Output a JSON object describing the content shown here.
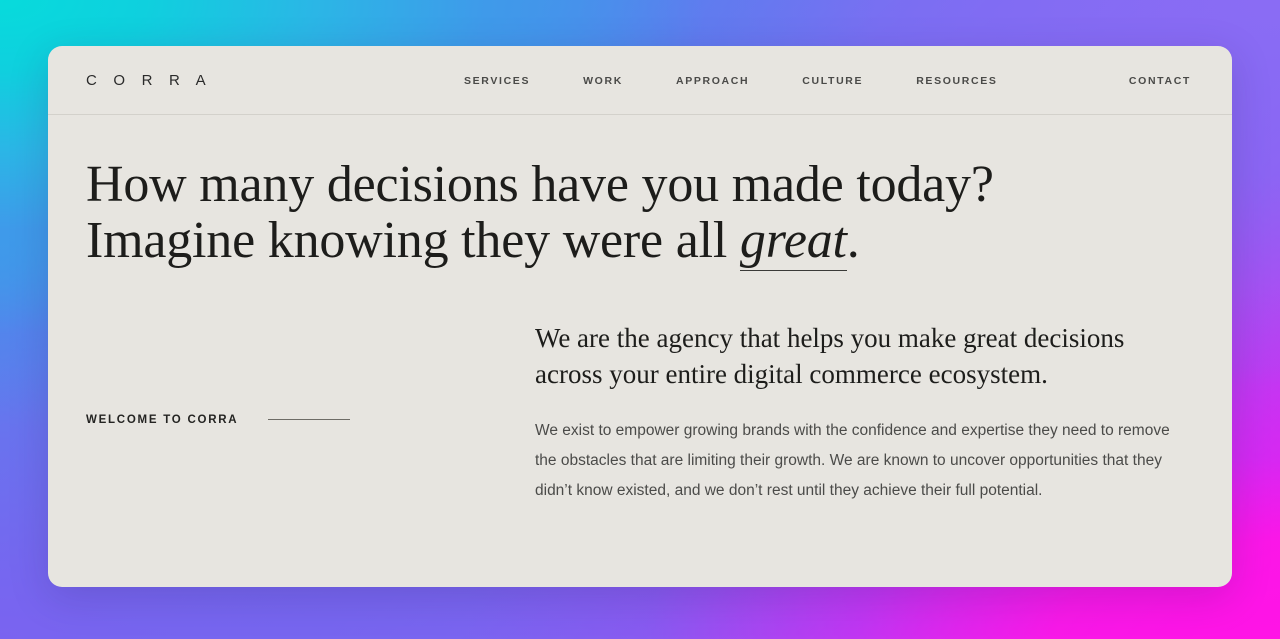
{
  "theme": {
    "card_bg": "#e7e5e0",
    "text_primary": "#1d1d1b",
    "text_secondary": "#4b4b49",
    "nav_text": "#4a4a48",
    "divider": "#d3d1cb",
    "gradient_top_left": "#0ed2da",
    "gradient_top_right": "#8a6cf4",
    "gradient_bottom_left": "#7a63f0",
    "gradient_bottom_right": "#f518ef"
  },
  "header": {
    "brand": "C O R R A",
    "nav": [
      {
        "label": "SERVICES"
      },
      {
        "label": "WORK"
      },
      {
        "label": "APPROACH"
      },
      {
        "label": "CULTURE"
      },
      {
        "label": "RESOURCES"
      }
    ],
    "contact": "CONTACT"
  },
  "hero": {
    "line1": "How many decisions have you made today?",
    "line2_before": "Imagine knowing they were all ",
    "line2_emphasis": "great",
    "line2_after": "."
  },
  "intro": {
    "eyebrow": "WELCOME TO CORRA",
    "lead": "We are the agency that helps you make great decisions across your entire digital commerce ecosystem.",
    "body": "We exist to empower growing brands with the confidence and expertise they need to remove the obstacles that are limiting their growth. We are known to uncover opportunities that they didn’t know existed, and we don’t rest until they achieve their full potential."
  }
}
